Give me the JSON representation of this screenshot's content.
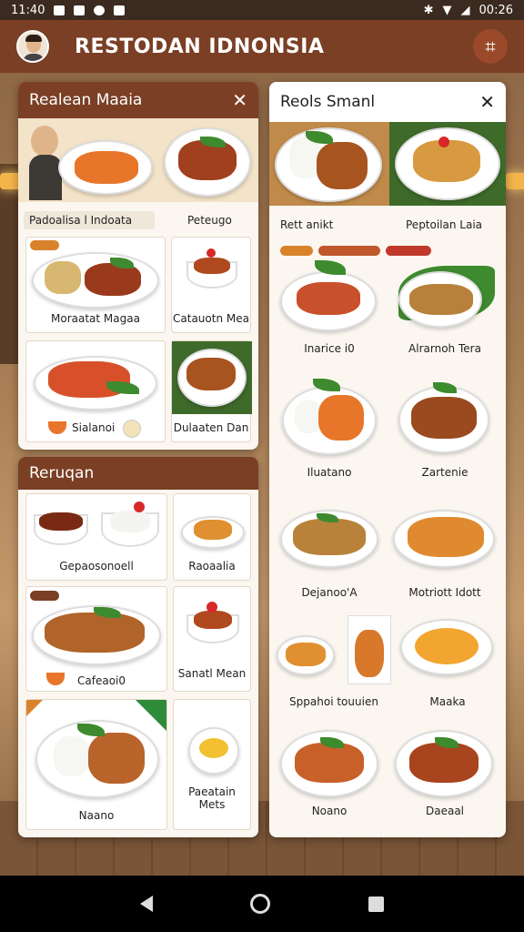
{
  "status": {
    "time": "11:40",
    "right_time": "00:26"
  },
  "app": {
    "title": "RESTODAN IDNONSIA",
    "menu_icon": "menu-icon"
  },
  "left_top_panel": {
    "title": "Realean Maaia",
    "hero_caption_left": "Padoalisa l Indoata",
    "hero_caption_right": "Peteugo",
    "items": [
      {
        "label": "Moraatat Magaa",
        "badge": ""
      },
      {
        "label": "Catauotn Mea"
      },
      {
        "label": "Sialanoi"
      },
      {
        "label": "Dulaaten Dan"
      }
    ]
  },
  "left_bottom_panel": {
    "title": "Reruqan",
    "items": [
      {
        "label": "Gepaosonoell"
      },
      {
        "label": "Raoaalia"
      },
      {
        "label": "Cafeaoi0"
      },
      {
        "label": "Sanatl Mean"
      },
      {
        "label": "Naano"
      },
      {
        "label": "Paeatain Mets"
      }
    ]
  },
  "right_panel": {
    "title": "Reols Smanl",
    "hero_caption_left": "Rett anikt",
    "hero_caption_right": "Peptoilan Laia",
    "items": [
      {
        "label": "Inarice i0"
      },
      {
        "label": "Alrarnoh Tera"
      },
      {
        "label": "Iluatano"
      },
      {
        "label": "Zartenie"
      },
      {
        "label": "Dejanoo'A"
      },
      {
        "label": "Motriott Idott"
      },
      {
        "label": "Sppahoi touuien"
      },
      {
        "label": "Maaka"
      },
      {
        "label": "Noano"
      },
      {
        "label": "Daeaal"
      }
    ]
  },
  "colors": {
    "header_brown": "#7a3f24",
    "badge_orange": "#d9822b",
    "badge_red": "#c0392b",
    "badge_green": "#2e8b3a"
  }
}
